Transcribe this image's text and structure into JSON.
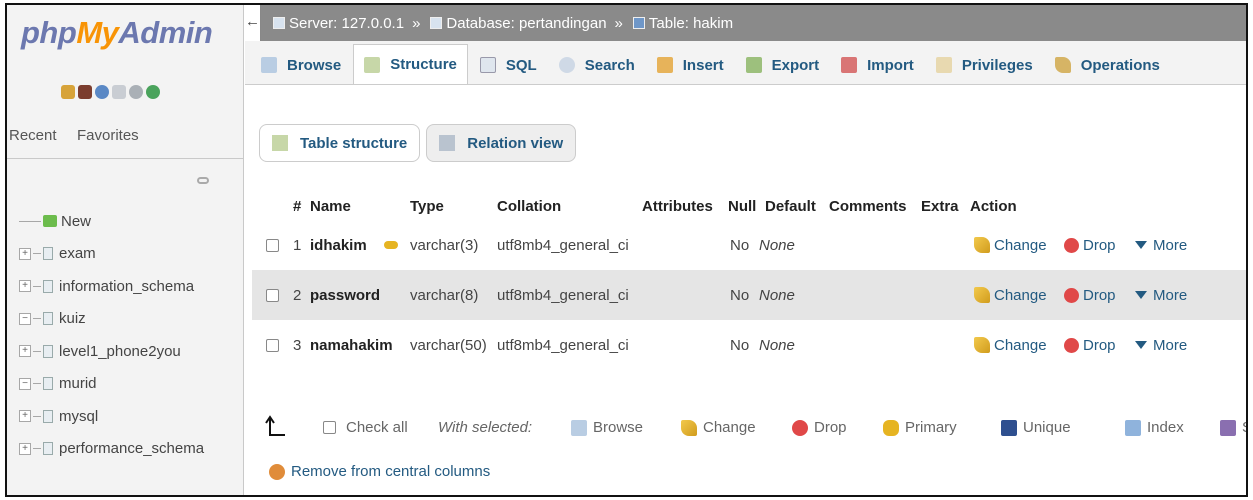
{
  "logo": {
    "php": "php",
    "my": "My",
    "admin": "Admin"
  },
  "left_tabs": {
    "recent": "Recent",
    "favorites": "Favorites"
  },
  "databases": [
    {
      "label": "New",
      "kind": "new"
    },
    {
      "label": "exam",
      "kind": "plus"
    },
    {
      "label": "information_schema",
      "kind": "plus"
    },
    {
      "label": "kuiz",
      "kind": "minus"
    },
    {
      "label": "level1_phone2you",
      "kind": "plus"
    },
    {
      "label": "murid",
      "kind": "minus"
    },
    {
      "label": "mysql",
      "kind": "plus"
    },
    {
      "label": "performance_schema",
      "kind": "plus"
    }
  ],
  "breadcrumb": {
    "toggle": "←",
    "server": "Server: 127.0.0.1",
    "database": "Database: pertandingan",
    "table": "Table: hakim",
    "sep": "»"
  },
  "menu": {
    "browse": "Browse",
    "structure": "Structure",
    "sql": "SQL",
    "search": "Search",
    "insert": "Insert",
    "export": "Export",
    "import": "Import",
    "privileges": "Privileges",
    "operations": "Operations"
  },
  "subtabs": {
    "table_structure": "Table structure",
    "relation_view": "Relation view"
  },
  "columns": {
    "num": "#",
    "name": "Name",
    "type": "Type",
    "collation": "Collation",
    "attributes": "Attributes",
    "null": "Null",
    "default": "Default",
    "comments": "Comments",
    "extra": "Extra",
    "action": "Action"
  },
  "rows": [
    {
      "num": "1",
      "name": "idhakim",
      "type": "varchar(3)",
      "collation": "utf8mb4_general_ci",
      "null": "No",
      "default": "None",
      "primary": true
    },
    {
      "num": "2",
      "name": "password",
      "type": "varchar(8)",
      "collation": "utf8mb4_general_ci",
      "null": "No",
      "default": "None",
      "primary": false
    },
    {
      "num": "3",
      "name": "namahakim",
      "type": "varchar(50)",
      "collation": "utf8mb4_general_ci",
      "null": "No",
      "default": "None",
      "primary": false
    }
  ],
  "row_actions": {
    "change": "Change",
    "drop": "Drop",
    "more": "More"
  },
  "footer": {
    "check_all": "Check all",
    "with_selected": "With selected:",
    "browse": "Browse",
    "change": "Change",
    "drop": "Drop",
    "primary": "Primary",
    "unique": "Unique",
    "index": "Index",
    "spatial": "Sp",
    "remove_central": "Remove from central columns"
  }
}
